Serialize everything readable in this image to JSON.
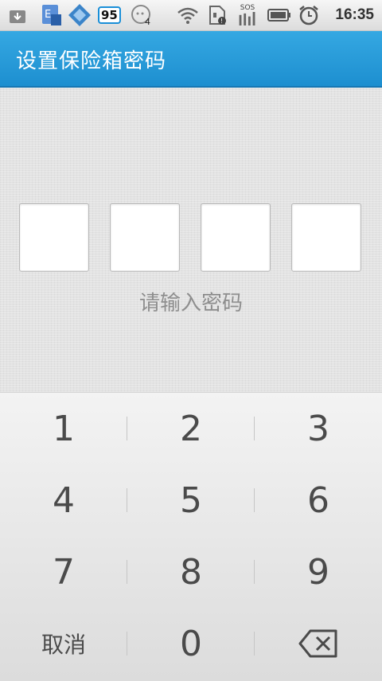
{
  "status_bar": {
    "time": "16:35",
    "badge_number": "95",
    "bubble_count": "4",
    "sos_label": "SOS",
    "icons": [
      "download-icon",
      "sim-card-icon",
      "app-diamond-icon",
      "battery-badge-icon",
      "chat-bubble-icon",
      "wifi-icon",
      "sd-card-icon",
      "signal-icon",
      "battery-icon",
      "alarm-icon"
    ]
  },
  "title_bar": {
    "title": "设置保险箱密码"
  },
  "pin": {
    "box_count": 4,
    "hint": "请输入密码"
  },
  "keypad": {
    "keys": [
      "1",
      "2",
      "3",
      "4",
      "5",
      "6",
      "7",
      "8",
      "9"
    ],
    "cancel_label": "取消",
    "zero_label": "0",
    "backspace_icon": "backspace-icon"
  },
  "colors": {
    "title_bar": "#1d8fd0",
    "status_badge": "#1a8fd8"
  }
}
